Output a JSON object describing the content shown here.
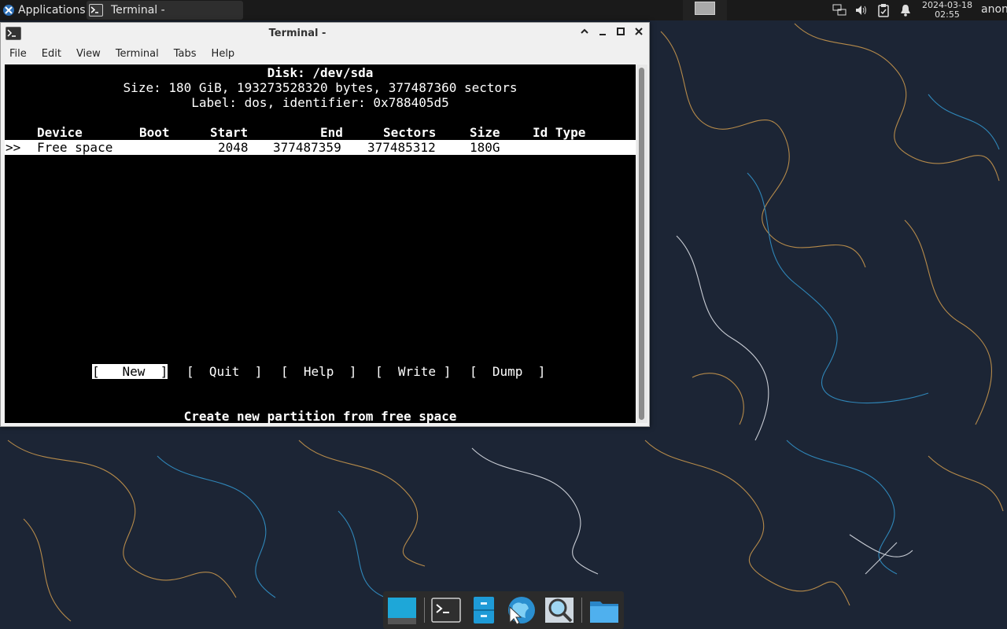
{
  "panel": {
    "applications_label": "Applications",
    "task_label": "Terminal -",
    "clock_date": "2024-03-18",
    "clock_time": "02:55",
    "user": "anon",
    "icons": [
      "network-icon",
      "volume-icon",
      "clipboard-icon",
      "notification-bell-icon"
    ]
  },
  "window": {
    "title": "Terminal -",
    "menu": [
      "File",
      "Edit",
      "View",
      "Terminal",
      "Tabs",
      "Help"
    ]
  },
  "cfdisk": {
    "disk_line": "Disk: /dev/sda",
    "size_line": "Size: 180 GiB, 193273528320 bytes, 377487360 sectors",
    "label_line": "Label: dos, identifier: 0x788405d5",
    "headers": {
      "device": "Device",
      "boot": "Boot",
      "start": "Start",
      "end": "End",
      "sectors": "Sectors",
      "size": "Size",
      "id_type": "Id Type"
    },
    "rows": [
      {
        "cursor": ">>",
        "device": "Free space",
        "boot": "",
        "start": "2048",
        "end": "377487359",
        "sectors": "377485312",
        "size": "180G",
        "id_type": ""
      }
    ],
    "buttons": [
      "[   New  ]",
      "[  Quit  ]",
      "[  Help  ]",
      "[  Write ]",
      "[  Dump  ]"
    ],
    "selected_button_index": 0,
    "hint": "Create new partition from free space"
  },
  "dock": {
    "items": [
      "show-desktop-icon",
      "terminal-icon",
      "file-cabinet-icon",
      "web-browser-icon",
      "search-magnifier-icon",
      "folder-icon"
    ]
  },
  "colors": {
    "wallpaper_bg": "#1c2535",
    "line_orange": "#b58a4a",
    "line_blue": "#2f86b8",
    "line_white": "#c8ccd4"
  }
}
